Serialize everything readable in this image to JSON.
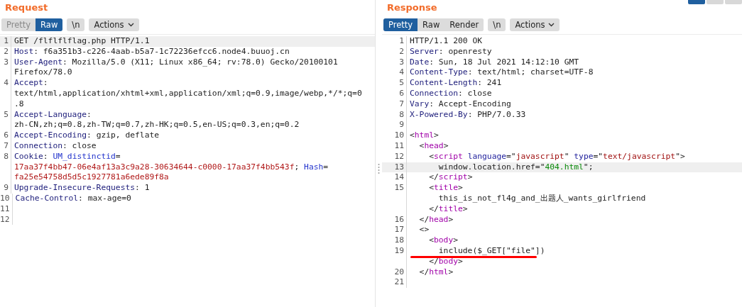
{
  "panels": [
    {
      "title": "Request",
      "view_tabs": [
        {
          "label": "Pretty",
          "selected": false
        },
        {
          "label": "Raw",
          "selected": true
        }
      ],
      "newline_button": "\\n",
      "actions_button": "Actions",
      "lines": [
        {
          "number": "1",
          "highlighted": true,
          "underlined": false,
          "rows": [
            {
              "parts": [
                {
                  "kind": "text",
                  "text": "GET /flflflflag.php HTTP/1.1"
                }
              ]
            }
          ]
        },
        {
          "number": "2",
          "highlighted": false,
          "underlined": false,
          "rows": [
            {
              "parts": [
                {
                  "kind": "key",
                  "text": "Host"
                },
                {
                  "kind": "text",
                  "text": ": f6a351b3-c226-4aab-b5a7-1c72236efcc6.node4.buuoj.cn"
                }
              ]
            }
          ]
        },
        {
          "number": "3",
          "highlighted": false,
          "underlined": false,
          "rows": [
            {
              "parts": [
                {
                  "kind": "key",
                  "text": "User-Agent"
                },
                {
                  "kind": "text",
                  "text": ": Mozilla/5.0 (X11; Linux x86_64; rv:78.0) Gecko/20100101"
                }
              ]
            },
            {
              "parts": [
                {
                  "kind": "text",
                  "text": "Firefox/78.0"
                }
              ]
            }
          ]
        },
        {
          "number": "4",
          "highlighted": false,
          "underlined": false,
          "rows": [
            {
              "parts": [
                {
                  "kind": "key",
                  "text": "Accept"
                },
                {
                  "kind": "text",
                  "text": ":"
                }
              ]
            },
            {
              "parts": [
                {
                  "kind": "text",
                  "text": "text/html,application/xhtml+xml,application/xml;q=0.9,image/webp,*/*;q=0"
                }
              ]
            },
            {
              "parts": [
                {
                  "kind": "text",
                  "text": ".8"
                }
              ]
            }
          ]
        },
        {
          "number": "5",
          "highlighted": false,
          "underlined": false,
          "rows": [
            {
              "parts": [
                {
                  "kind": "key",
                  "text": "Accept-Language"
                },
                {
                  "kind": "text",
                  "text": ":"
                }
              ]
            },
            {
              "parts": [
                {
                  "kind": "text",
                  "text": "zh-CN,zh;q=0.8,zh-TW;q=0.7,zh-HK;q=0.5,en-US;q=0.3,en;q=0.2"
                }
              ]
            }
          ]
        },
        {
          "number": "6",
          "highlighted": false,
          "underlined": false,
          "rows": [
            {
              "parts": [
                {
                  "kind": "key",
                  "text": "Accept-Encoding"
                },
                {
                  "kind": "text",
                  "text": ": gzip, deflate"
                }
              ]
            }
          ]
        },
        {
          "number": "7",
          "highlighted": false,
          "underlined": false,
          "rows": [
            {
              "parts": [
                {
                  "kind": "key",
                  "text": "Connection"
                },
                {
                  "kind": "text",
                  "text": ": close"
                }
              ]
            }
          ]
        },
        {
          "number": "8",
          "highlighted": false,
          "underlined": false,
          "rows": [
            {
              "parts": [
                {
                  "kind": "key",
                  "text": "Cookie"
                },
                {
                  "kind": "text",
                  "text": ": "
                },
                {
                  "kind": "param",
                  "text": "UM_distinctid"
                },
                {
                  "kind": "text",
                  "text": "="
                }
              ]
            },
            {
              "parts": [
                {
                  "kind": "value",
                  "text": "17aa37f4bb47-06e4af13a3c9a28-30634644-c0000-17aa37f4bb543f"
                },
                {
                  "kind": "text",
                  "text": "; "
                },
                {
                  "kind": "param",
                  "text": "Hash"
                },
                {
                  "kind": "text",
                  "text": "="
                }
              ]
            },
            {
              "parts": [
                {
                  "kind": "value",
                  "text": "fa25e54758d5d5c1927781a6ede89f8a"
                }
              ]
            }
          ]
        },
        {
          "number": "9",
          "highlighted": false,
          "underlined": false,
          "rows": [
            {
              "parts": [
                {
                  "kind": "key",
                  "text": "Upgrade-Insecure-Requests"
                },
                {
                  "kind": "text",
                  "text": ": 1"
                }
              ]
            }
          ]
        },
        {
          "number": "10",
          "highlighted": false,
          "underlined": false,
          "rows": [
            {
              "parts": [
                {
                  "kind": "key",
                  "text": "Cache-Control"
                },
                {
                  "kind": "text",
                  "text": ": max-age=0"
                }
              ]
            }
          ]
        },
        {
          "number": "11",
          "highlighted": false,
          "underlined": false,
          "rows": [
            {
              "parts": []
            }
          ]
        },
        {
          "number": "12",
          "highlighted": false,
          "underlined": false,
          "rows": [
            {
              "parts": []
            }
          ]
        }
      ]
    },
    {
      "title": "Response",
      "view_tabs": [
        {
          "label": "Pretty",
          "selected": true
        },
        {
          "label": "Raw",
          "selected": false
        },
        {
          "label": "Render",
          "selected": false
        }
      ],
      "newline_button": "\\n",
      "actions_button": "Actions",
      "lines": [
        {
          "number": "1",
          "highlighted": false,
          "underlined": false,
          "rows": [
            {
              "parts": [
                {
                  "kind": "text",
                  "text": "HTTP/1.1 200 OK"
                }
              ]
            }
          ]
        },
        {
          "number": "2",
          "highlighted": false,
          "underlined": false,
          "rows": [
            {
              "parts": [
                {
                  "kind": "key",
                  "text": "Server"
                },
                {
                  "kind": "text",
                  "text": ": openresty"
                }
              ]
            }
          ]
        },
        {
          "number": "3",
          "highlighted": false,
          "underlined": false,
          "rows": [
            {
              "parts": [
                {
                  "kind": "key",
                  "text": "Date"
                },
                {
                  "kind": "text",
                  "text": ": Sun, 18 Jul 2021 14:12:10 GMT"
                }
              ]
            }
          ]
        },
        {
          "number": "4",
          "highlighted": false,
          "underlined": false,
          "rows": [
            {
              "parts": [
                {
                  "kind": "key",
                  "text": "Content-Type"
                },
                {
                  "kind": "text",
                  "text": ": text/html; charset=UTF-8"
                }
              ]
            }
          ]
        },
        {
          "number": "5",
          "highlighted": false,
          "underlined": false,
          "rows": [
            {
              "parts": [
                {
                  "kind": "key",
                  "text": "Content-Length"
                },
                {
                  "kind": "text",
                  "text": ": 241"
                }
              ]
            }
          ]
        },
        {
          "number": "6",
          "highlighted": false,
          "underlined": false,
          "rows": [
            {
              "parts": [
                {
                  "kind": "key",
                  "text": "Connection"
                },
                {
                  "kind": "text",
                  "text": ": close"
                }
              ]
            }
          ]
        },
        {
          "number": "7",
          "highlighted": false,
          "underlined": false,
          "rows": [
            {
              "parts": [
                {
                  "kind": "key",
                  "text": "Vary"
                },
                {
                  "kind": "text",
                  "text": ": Accept-Encoding"
                }
              ]
            }
          ]
        },
        {
          "number": "8",
          "highlighted": false,
          "underlined": false,
          "rows": [
            {
              "parts": [
                {
                  "kind": "key",
                  "text": "X-Powered-By"
                },
                {
                  "kind": "text",
                  "text": ": PHP/7.0.33"
                }
              ]
            }
          ]
        },
        {
          "number": "9",
          "highlighted": false,
          "underlined": false,
          "rows": [
            {
              "parts": []
            }
          ]
        },
        {
          "number": "10",
          "highlighted": false,
          "underlined": false,
          "rows": [
            {
              "parts": [
                {
                  "kind": "text",
                  "text": "<"
                },
                {
                  "kind": "tag",
                  "text": "html"
                },
                {
                  "kind": "text",
                  "text": ">"
                }
              ]
            }
          ]
        },
        {
          "number": "11",
          "highlighted": false,
          "underlined": false,
          "rows": [
            {
              "parts": [
                {
                  "kind": "text",
                  "text": "  <"
                },
                {
                  "kind": "tag",
                  "text": "head"
                },
                {
                  "kind": "text",
                  "text": ">"
                }
              ]
            }
          ]
        },
        {
          "number": "12",
          "highlighted": false,
          "underlined": false,
          "rows": [
            {
              "parts": [
                {
                  "kind": "text",
                  "text": "    <"
                },
                {
                  "kind": "tag",
                  "text": "script "
                },
                {
                  "kind": "attr",
                  "text": "language"
                },
                {
                  "kind": "text",
                  "text": "=\""
                },
                {
                  "kind": "string",
                  "text": "javascript"
                },
                {
                  "kind": "text",
                  "text": "\" "
                },
                {
                  "kind": "attr",
                  "text": "type"
                },
                {
                  "kind": "text",
                  "text": "=\""
                },
                {
                  "kind": "string",
                  "text": "text/javascript"
                },
                {
                  "kind": "text",
                  "text": "\">"
                }
              ]
            }
          ]
        },
        {
          "number": "13",
          "highlighted": true,
          "underlined": false,
          "rows": [
            {
              "parts": [
                {
                  "kind": "text",
                  "text": "      window.location.href=\""
                },
                {
                  "kind": "js_string",
                  "text": "404.html"
                },
                {
                  "kind": "text",
                  "text": "\";"
                }
              ]
            }
          ]
        },
        {
          "number": "14",
          "highlighted": false,
          "underlined": false,
          "rows": [
            {
              "parts": [
                {
                  "kind": "text",
                  "text": "    </"
                },
                {
                  "kind": "tag",
                  "text": "script"
                },
                {
                  "kind": "text",
                  "text": ">"
                }
              ]
            }
          ]
        },
        {
          "number": "15",
          "highlighted": false,
          "underlined": false,
          "rows": [
            {
              "parts": [
                {
                  "kind": "text",
                  "text": "    <"
                },
                {
                  "kind": "tag",
                  "text": "title"
                },
                {
                  "kind": "text",
                  "text": ">"
                }
              ]
            },
            {
              "parts": [
                {
                  "kind": "text",
                  "text": "      this_is_not_fl4g_and_出题人_wants_girlfriend"
                }
              ]
            },
            {
              "parts": [
                {
                  "kind": "text",
                  "text": "    </"
                },
                {
                  "kind": "tag",
                  "text": "title"
                },
                {
                  "kind": "text",
                  "text": ">"
                }
              ]
            }
          ]
        },
        {
          "number": "16",
          "highlighted": false,
          "underlined": false,
          "rows": [
            {
              "parts": [
                {
                  "kind": "text",
                  "text": "  </"
                },
                {
                  "kind": "tag",
                  "text": "head"
                },
                {
                  "kind": "text",
                  "text": ">"
                }
              ]
            }
          ]
        },
        {
          "number": "17",
          "highlighted": false,
          "underlined": false,
          "rows": [
            {
              "parts": [
                {
                  "kind": "text",
                  "text": "  <>"
                }
              ]
            }
          ]
        },
        {
          "number": "18",
          "highlighted": false,
          "underlined": false,
          "rows": [
            {
              "parts": [
                {
                  "kind": "text",
                  "text": "    <"
                },
                {
                  "kind": "tag",
                  "text": "body"
                },
                {
                  "kind": "text",
                  "text": ">"
                }
              ]
            }
          ]
        },
        {
          "number": "19",
          "highlighted": false,
          "underlined": true,
          "rows": [
            {
              "parts": [
                {
                  "kind": "text",
                  "text": "      include($_GET[\"file\"])"
                }
              ]
            },
            {
              "parts": [
                {
                  "kind": "text",
                  "text": "    </"
                },
                {
                  "kind": "tag",
                  "text": "body"
                },
                {
                  "kind": "text",
                  "text": ">"
                }
              ]
            }
          ]
        },
        {
          "number": "20",
          "highlighted": false,
          "underlined": false,
          "rows": [
            {
              "parts": [
                {
                  "kind": "text",
                  "text": "  </"
                },
                {
                  "kind": "tag",
                  "text": "html"
                },
                {
                  "kind": "text",
                  "text": ">"
                }
              ]
            }
          ]
        },
        {
          "number": "21",
          "highlighted": false,
          "underlined": false,
          "rows": [
            {
              "parts": []
            }
          ]
        }
      ]
    }
  ]
}
